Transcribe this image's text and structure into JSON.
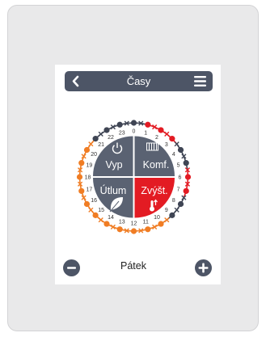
{
  "header": {
    "title": "Časy",
    "back_icon": "chevron-left-icon",
    "menu_icon": "hamburger-menu-icon"
  },
  "modes": {
    "off": {
      "label": "Vyp",
      "icon": "power-icon"
    },
    "comfort": {
      "label": "Komf.",
      "icon": "radiator-icon"
    },
    "setback": {
      "label": "Útlum",
      "icon": "leaf-icon"
    },
    "boost": {
      "label": "Zvýšt.",
      "icon": "thermometer-up-icon"
    }
  },
  "dial": {
    "hours": [
      "0",
      "1",
      "2",
      "3",
      "4",
      "5",
      "6",
      "7",
      "8",
      "9",
      "10",
      "11",
      "12",
      "13",
      "14",
      "15",
      "16",
      "17",
      "18",
      "19",
      "20",
      "21",
      "22",
      "23"
    ],
    "half_hour_modes": [
      "dark",
      "dark",
      "red",
      "red",
      "red",
      "red",
      "red",
      "dark",
      "dark",
      "dark",
      "dark",
      "red",
      "red",
      "red",
      "red",
      "dark",
      "dark",
      "dark",
      "dark",
      "orange",
      "orange",
      "orange",
      "orange",
      "orange",
      "orange",
      "orange",
      "orange",
      "orange",
      "orange",
      "orange",
      "orange",
      "orange",
      "orange",
      "orange",
      "orange",
      "orange",
      "orange",
      "orange",
      "orange",
      "orange",
      "orange",
      "orange",
      "dark",
      "dark",
      "dark",
      "dark",
      "dark",
      "dark"
    ],
    "colors": {
      "dark": "#3f4554",
      "red": "#e31b23",
      "orange": "#f07d24",
      "segment": "#5a6272"
    }
  },
  "footer": {
    "day": "Pátek",
    "minus_icon": "minus-icon",
    "plus_icon": "plus-icon"
  }
}
